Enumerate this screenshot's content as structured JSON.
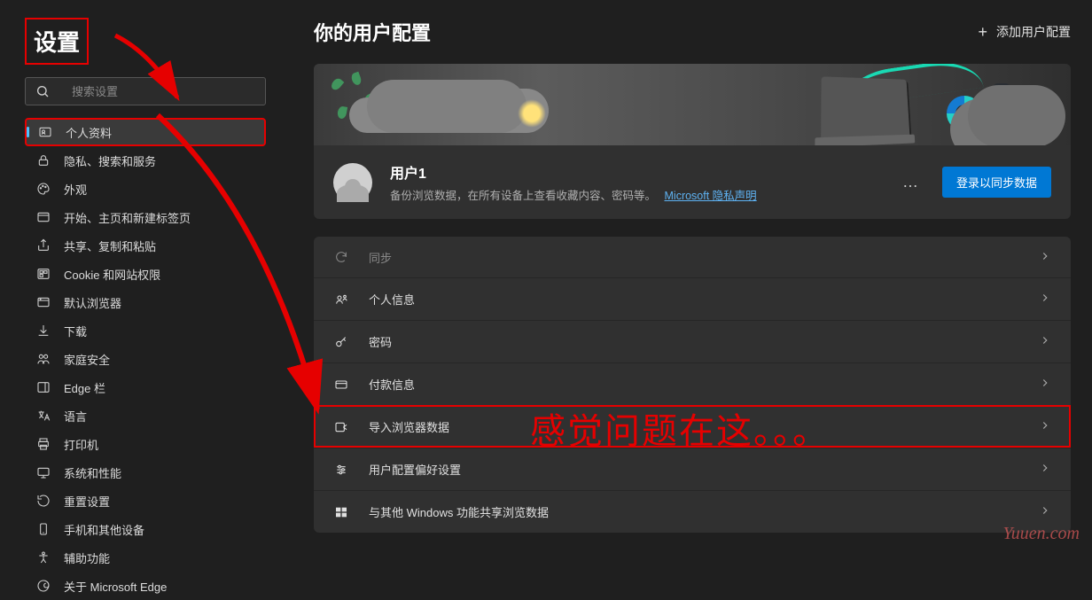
{
  "sidebar": {
    "title": "设置",
    "search_placeholder": "搜索设置",
    "items": [
      {
        "icon": "person-card-icon",
        "label": "个人资料",
        "active": true
      },
      {
        "icon": "lock-icon",
        "label": "隐私、搜索和服务"
      },
      {
        "icon": "palette-icon",
        "label": "外观"
      },
      {
        "icon": "window-icon",
        "label": "开始、主页和新建标签页"
      },
      {
        "icon": "share-icon",
        "label": "共享、复制和粘贴"
      },
      {
        "icon": "cookie-icon",
        "label": "Cookie 和网站权限"
      },
      {
        "icon": "browser-icon",
        "label": "默认浏览器"
      },
      {
        "icon": "download-icon",
        "label": "下载"
      },
      {
        "icon": "family-icon",
        "label": "家庭安全"
      },
      {
        "icon": "sidebar-icon",
        "label": "Edge 栏"
      },
      {
        "icon": "language-icon",
        "label": "语言"
      },
      {
        "icon": "printer-icon",
        "label": "打印机"
      },
      {
        "icon": "performance-icon",
        "label": "系统和性能"
      },
      {
        "icon": "reset-icon",
        "label": "重置设置"
      },
      {
        "icon": "phone-icon",
        "label": "手机和其他设备"
      },
      {
        "icon": "accessibility-icon",
        "label": "辅助功能"
      },
      {
        "icon": "edge-icon",
        "label": "关于 Microsoft Edge"
      }
    ]
  },
  "header": {
    "page_title": "你的用户配置",
    "add_profile": "添加用户配置"
  },
  "profile": {
    "name": "用户1",
    "description": "备份浏览数据，在所有设备上查看收藏内容、密码等。",
    "privacy_link": "Microsoft 隐私声明",
    "more": "…",
    "signin": "登录以同步数据"
  },
  "rows": [
    {
      "icon": "sync-icon",
      "label": "同步",
      "disabled": true
    },
    {
      "icon": "personal-info-icon",
      "label": "个人信息"
    },
    {
      "icon": "key-icon",
      "label": "密码"
    },
    {
      "icon": "card-icon",
      "label": "付款信息"
    },
    {
      "icon": "import-icon",
      "label": "导入浏览器数据",
      "highlighted": true
    },
    {
      "icon": "preferences-icon",
      "label": "用户配置偏好设置"
    },
    {
      "icon": "windows-icon",
      "label": "与其他 Windows 功能共享浏览数据"
    }
  ],
  "annotation": {
    "text": "感觉问题在这。。。",
    "watermark": "Yuuen.com"
  }
}
